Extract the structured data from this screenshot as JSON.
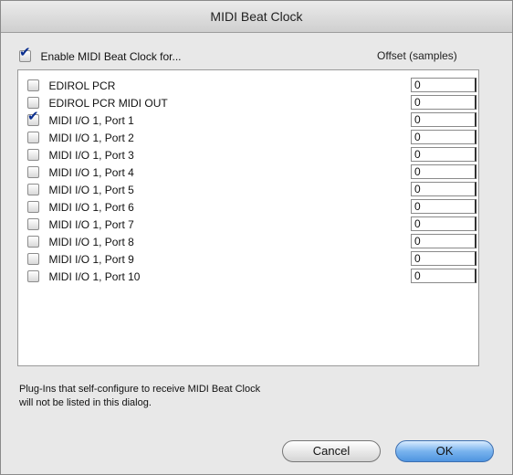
{
  "window": {
    "title": "MIDI Beat Clock"
  },
  "enable": {
    "label": "Enable MIDI Beat Clock for...",
    "checked": true
  },
  "offset_header": "Offset (samples)",
  "devices": [
    {
      "label": "EDIROL PCR",
      "checked": false,
      "offset": "0"
    },
    {
      "label": "EDIROL PCR MIDI OUT",
      "checked": false,
      "offset": "0"
    },
    {
      "label": "MIDI I/O 1, Port 1",
      "checked": true,
      "offset": "0"
    },
    {
      "label": "MIDI I/O 1, Port 2",
      "checked": false,
      "offset": "0"
    },
    {
      "label": "MIDI I/O 1, Port 3",
      "checked": false,
      "offset": "0"
    },
    {
      "label": "MIDI I/O 1, Port 4",
      "checked": false,
      "offset": "0"
    },
    {
      "label": "MIDI I/O 1, Port 5",
      "checked": false,
      "offset": "0"
    },
    {
      "label": "MIDI I/O 1, Port 6",
      "checked": false,
      "offset": "0"
    },
    {
      "label": "MIDI I/O 1, Port 7",
      "checked": false,
      "offset": "0"
    },
    {
      "label": "MIDI I/O 1, Port 8",
      "checked": false,
      "offset": "0"
    },
    {
      "label": "MIDI I/O 1, Port 9",
      "checked": false,
      "offset": "0"
    },
    {
      "label": "MIDI I/O 1, Port 10",
      "checked": false,
      "offset": "0"
    }
  ],
  "note": {
    "line1": "Plug-Ins that self-configure to receive MIDI Beat Clock",
    "line2": "will not be listed in this dialog."
  },
  "buttons": {
    "cancel": "Cancel",
    "ok": "OK"
  },
  "colors": {
    "check": "#0b2f8f",
    "ok_button": "#5a9be3"
  }
}
